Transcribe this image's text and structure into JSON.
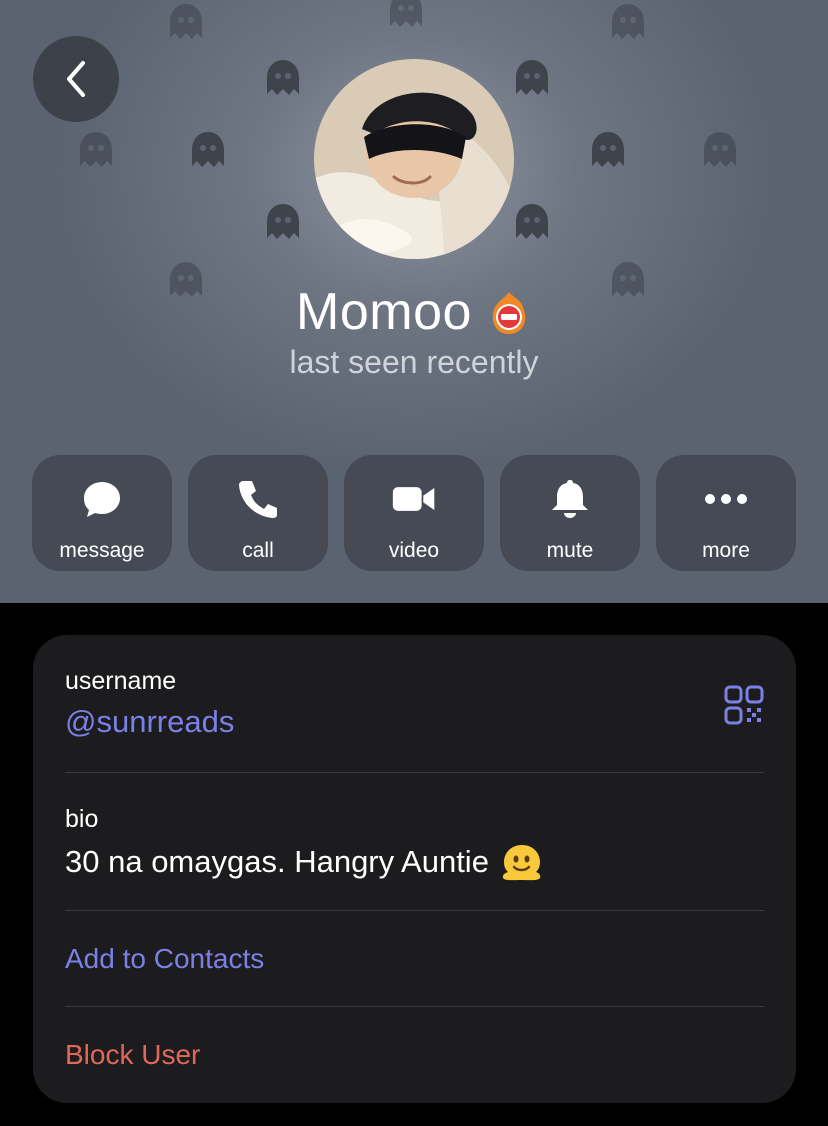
{
  "header": {
    "name": "Momoo",
    "status": "last seen recently"
  },
  "icons": {
    "back": "chevron-left-icon",
    "status_emoji": "fire-stop-sign-emoji",
    "qr": "qr-code-icon",
    "bio_emoji": "melting-face-emoji"
  },
  "actions": [
    {
      "label": "message",
      "icon": "chat-bubble-icon"
    },
    {
      "label": "call",
      "icon": "phone-icon"
    },
    {
      "label": "video",
      "icon": "video-camera-icon"
    },
    {
      "label": "mute",
      "icon": "bell-icon"
    },
    {
      "label": "more",
      "icon": "ellipsis-icon"
    }
  ],
  "info": {
    "username_label": "username",
    "username_value": "@sunrreads",
    "bio_label": "bio",
    "bio_value": "30 na omaygas. Hangry Auntie",
    "add_contact": "Add to Contacts",
    "block_user": "Block User"
  },
  "colors": {
    "accent": "#7b80e6",
    "danger": "#e0685a",
    "card_bg": "#1c1c1e",
    "button_bg": "#454a54"
  }
}
